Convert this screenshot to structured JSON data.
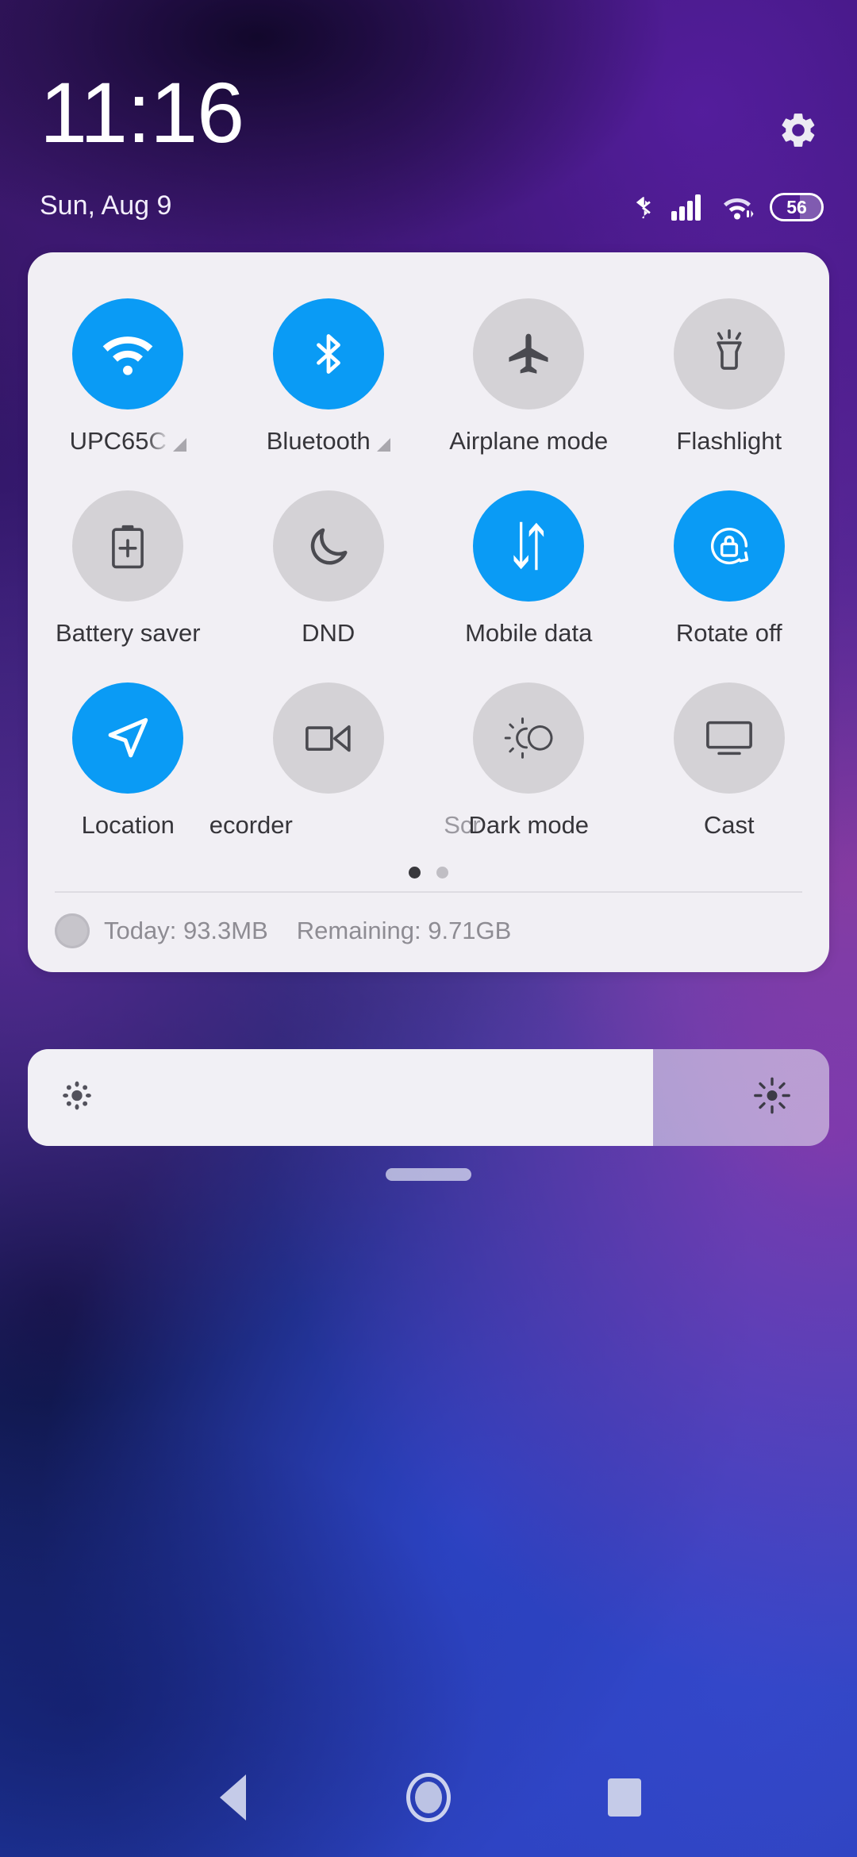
{
  "status": {
    "time": "11:16",
    "date": "Sun, Aug 9",
    "battery_percent": "56",
    "icons": [
      "bluetooth-icon",
      "cellular-signal-icon",
      "wifi-icon",
      "battery-icon"
    ],
    "settings_icon": "gear-icon"
  },
  "quick_settings": {
    "tiles": [
      {
        "label": "UPC65C",
        "icon": "wifi-icon",
        "active": true,
        "expandable": true,
        "truncated": true
      },
      {
        "label": "Bluetooth",
        "icon": "bluetooth-icon",
        "active": true,
        "expandable": true,
        "truncated": false
      },
      {
        "label": "Airplane mode",
        "icon": "airplane-icon",
        "active": false,
        "expandable": false,
        "truncated": false
      },
      {
        "label": "Flashlight",
        "icon": "flashlight-icon",
        "active": false,
        "expandable": false,
        "truncated": false
      },
      {
        "label": "Battery saver",
        "icon": "battery-plus-icon",
        "active": false,
        "expandable": false,
        "truncated": false
      },
      {
        "label": "DND",
        "icon": "moon-icon",
        "active": false,
        "expandable": false,
        "truncated": false
      },
      {
        "label": "Mobile data",
        "icon": "data-arrows-icon",
        "active": true,
        "expandable": false,
        "truncated": false
      },
      {
        "label": "Rotate off",
        "icon": "rotation-lock-icon",
        "active": true,
        "expandable": false,
        "truncated": false
      },
      {
        "label": "Location",
        "icon": "location-arrow-icon",
        "active": true,
        "expandable": false,
        "truncated": false
      },
      {
        "label": "Screen recorder",
        "icon": "video-camera-icon",
        "active": false,
        "expandable": false,
        "marquee": true,
        "marquee_left": "ecorder",
        "marquee_right": "Scr"
      },
      {
        "label": "Dark mode",
        "icon": "sun-moon-icon",
        "active": false,
        "expandable": false,
        "truncated": false
      },
      {
        "label": "Cast",
        "icon": "monitor-icon",
        "active": false,
        "expandable": false,
        "truncated": false
      }
    ],
    "pages": {
      "count": 2,
      "active_index": 0
    },
    "data_usage": {
      "today_label": "Today: 93.3MB",
      "remaining_label": "Remaining: 9.71GB",
      "icon": "data-circle-icon"
    }
  },
  "brightness": {
    "value_percent": 78,
    "low_icon": "brightness-low-icon",
    "high_icon": "brightness-high-icon"
  },
  "drag_handle": "panel-drag-handle",
  "navbar": {
    "back": "back-icon",
    "home": "home-icon",
    "recents": "recents-icon"
  },
  "colors": {
    "accent_on": "#0a9bf5",
    "tile_off": "#d4d2d6",
    "panel_bg": "#f1eff4",
    "label": "#36353a"
  }
}
